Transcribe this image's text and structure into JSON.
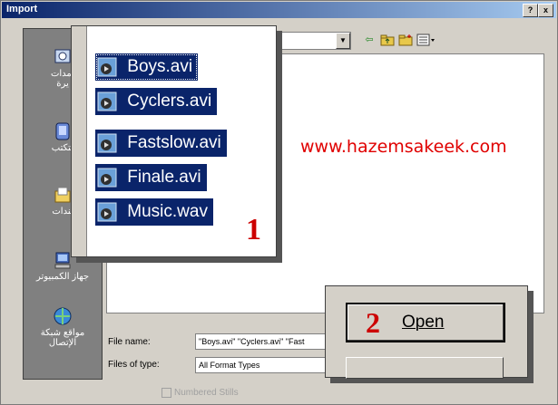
{
  "window": {
    "title": "Import"
  },
  "titlebar": {
    "help_label": "?",
    "close_label": "x"
  },
  "toolbar": {
    "icons": [
      "back-arrow-icon",
      "up-folder-icon",
      "new-folder-icon",
      "views-menu-icon"
    ]
  },
  "places": [
    {
      "label": "تمدات\nيرة",
      "icon": "recent-icon"
    },
    {
      "label": "لتكتب",
      "icon": "desktop-icon"
    },
    {
      "label": "تندات",
      "icon": "documents-icon"
    },
    {
      "label": "جهاز الكمبيوتر",
      "icon": "my-computer-icon"
    },
    {
      "label": "مواقع شبكة\nالإتصال",
      "icon": "network-icon"
    }
  ],
  "overlay": {
    "files": [
      "Boys.avi",
      "Cyclers.avi",
      "Fastslow.avi",
      "Finale.avi",
      "Music.wav"
    ],
    "step_number": "1"
  },
  "watermark": "www.hazemsakeek.com",
  "form": {
    "file_name_label": "File name:",
    "file_name_value": "\"Boys.avi\" \"Cyclers.avi\" \"Fast",
    "files_of_type_label": "Files of type:",
    "files_of_type_value": "All Format Types",
    "numbered_label": "Numbered Stills"
  },
  "zoom": {
    "step_number": "2",
    "open_label": "Open"
  },
  "colors": {
    "selection": "#0a246a",
    "annotation_red": "#cc0000",
    "dialog_face": "#d4d0c8"
  }
}
